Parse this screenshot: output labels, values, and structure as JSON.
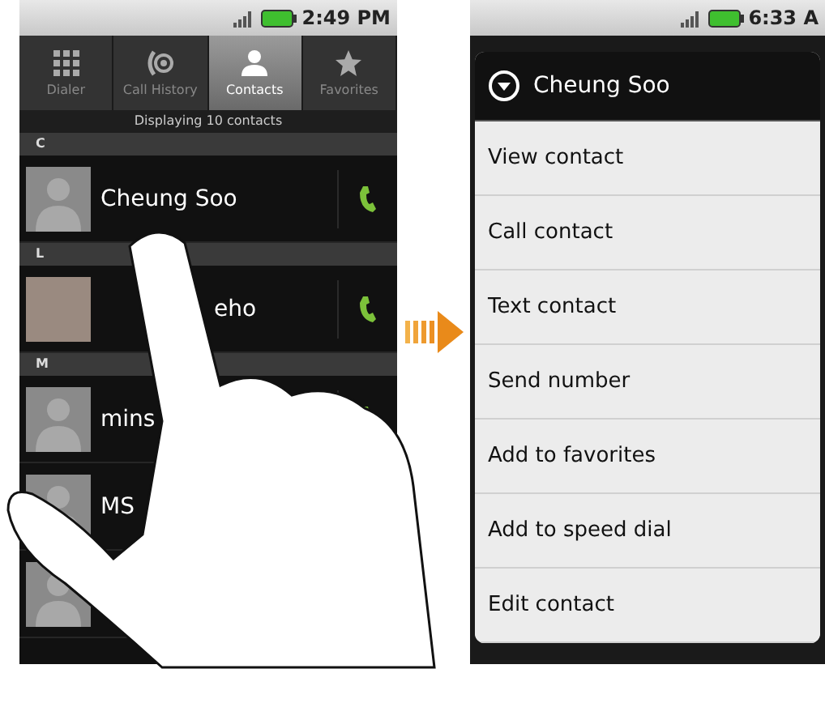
{
  "left_screen": {
    "status_bar": {
      "time": "2:49 PM"
    },
    "tabs": [
      {
        "kind": "dialer",
        "label": "Dialer",
        "selected": false
      },
      {
        "kind": "history",
        "label": "Call History",
        "selected": false
      },
      {
        "kind": "contacts",
        "label": "Contacts",
        "selected": true
      },
      {
        "kind": "favorites",
        "label": "Favorites",
        "selected": false
      }
    ],
    "list_caption": "Displaying 10 contacts",
    "sections": [
      {
        "letter": "C",
        "contacts": [
          {
            "name": "Cheung Soo",
            "kind": "silhouette"
          }
        ]
      },
      {
        "letter": "L",
        "contacts": [
          {
            "name": "eho",
            "kind": "photo"
          }
        ]
      },
      {
        "letter": "M",
        "contacts": [
          {
            "name": "mins",
            "kind": "silhouette"
          },
          {
            "name": "MS",
            "kind": "silhouette"
          },
          {
            "kind": "silhouette"
          }
        ]
      }
    ]
  },
  "right_screen": {
    "status_bar": {
      "time": "6:33 A"
    },
    "context_menu": {
      "title": "Cheung Soo",
      "items": [
        "View contact",
        "Call contact",
        "Text contact",
        "Send number",
        "Add to favorites",
        "Add to speed dial",
        "Edit contact"
      ]
    }
  }
}
